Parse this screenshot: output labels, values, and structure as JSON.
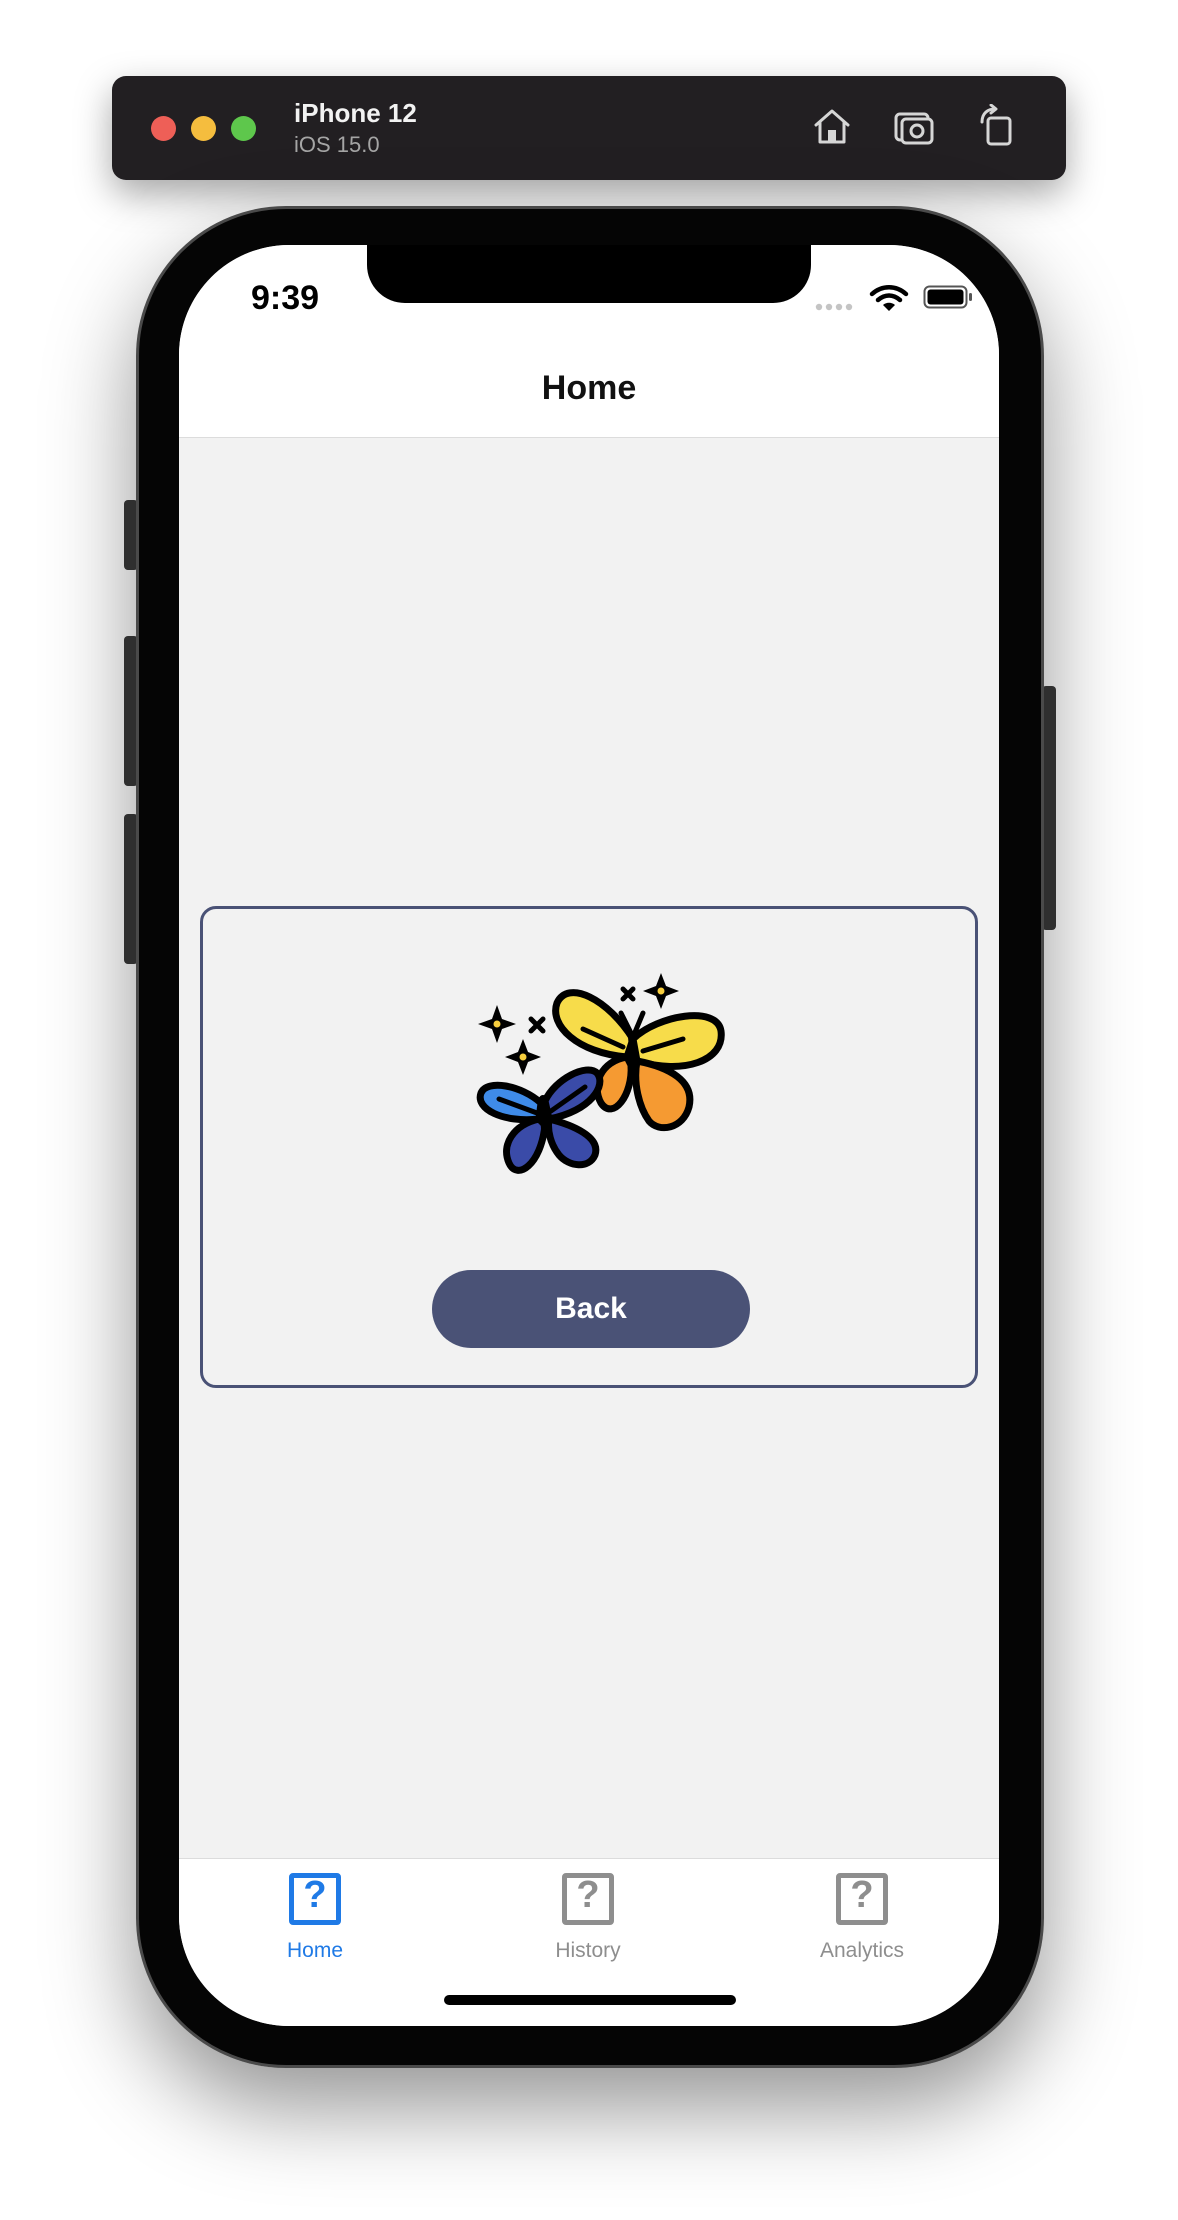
{
  "simulator": {
    "device_name": "iPhone 12",
    "os_version": "iOS 15.0",
    "icons": [
      "home-icon",
      "screenshot-icon",
      "rotate-icon"
    ]
  },
  "status_bar": {
    "time": "9:39",
    "icons": [
      "cellular-dots-icon",
      "wifi-icon",
      "battery-icon"
    ]
  },
  "nav": {
    "title": "Home"
  },
  "card": {
    "image_icon": "butterflies-sparkles-icon",
    "back_label": "Back"
  },
  "tab_bar": {
    "items": [
      {
        "label": "Home",
        "icon": "question-mark-icon",
        "selected": true
      },
      {
        "label": "History",
        "icon": "question-mark-icon",
        "selected": false
      },
      {
        "label": "Analytics",
        "icon": "question-mark-icon",
        "selected": false
      }
    ]
  },
  "colors": {
    "accent": "#1f7ae6",
    "button": "#4a5276",
    "inactive": "#8e8e8e",
    "background": "#f2f2f2"
  }
}
